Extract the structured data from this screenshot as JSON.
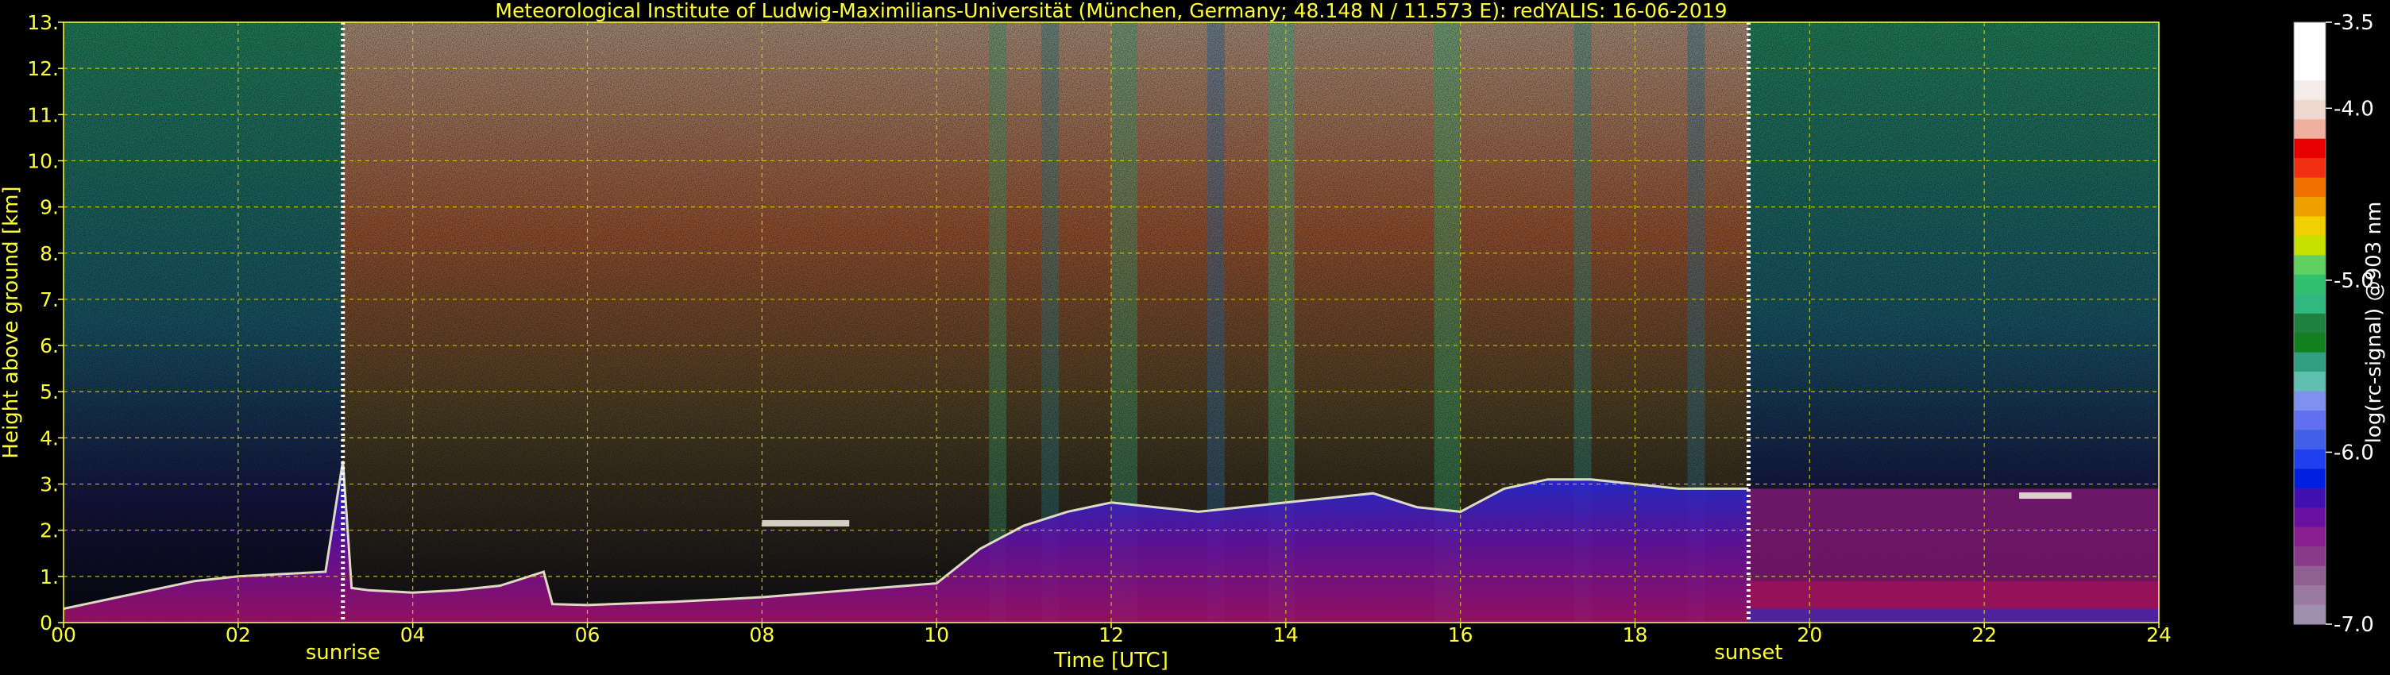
{
  "chart_data": {
    "type": "heatmap",
    "title": "Meteorological Institute of Ludwig-Maximilians-Universität (München, Germany; 48.148 N / 11.573 E):    redYALIS: 16-06-2019",
    "xlabel": "Time [UTC]",
    "ylabel": "Height above ground [km]",
    "xlim": [
      0,
      24
    ],
    "ylim": [
      0,
      13
    ],
    "x_ticks": [
      "00",
      "02",
      "04",
      "06",
      "08",
      "10",
      "12",
      "14",
      "16",
      "18",
      "20",
      "22",
      "24"
    ],
    "y_ticks": [
      "0.",
      "1.",
      "2.",
      "3.",
      "4.",
      "5.",
      "6.",
      "7.",
      "8.",
      "9.",
      "10.",
      "11.",
      "12.",
      "13."
    ],
    "grid": true,
    "annotations": [
      {
        "label": "sunrise",
        "time": 3.2
      },
      {
        "label": "sunset",
        "time": 19.3
      }
    ],
    "colorbar": {
      "label": "log(rc-signal) @903 nm",
      "range": [
        -7.0,
        -3.5
      ],
      "ticks": [
        "-3.5",
        "-4.0",
        "-5.0",
        "-6.0",
        "-7.0"
      ],
      "tick_values": [
        -3.5,
        -4.0,
        -5.0,
        -6.0,
        -7.0
      ]
    },
    "boundary_layer_top_km": {
      "time": [
        0.0,
        0.5,
        1.0,
        1.5,
        2.0,
        2.5,
        3.0,
        3.2,
        3.3,
        3.5,
        4.0,
        4.5,
        5.0,
        5.5,
        5.6,
        6.0,
        7.0,
        8.0,
        9.0,
        10.0,
        10.5,
        11.0,
        11.5,
        12.0,
        12.5,
        13.0,
        13.5,
        14.0,
        14.5,
        15.0,
        15.5,
        16.0,
        16.5,
        17.0,
        17.5,
        18.0,
        18.5,
        19.0,
        19.3
      ],
      "height": [
        0.3,
        0.5,
        0.7,
        0.9,
        1.0,
        1.05,
        1.1,
        3.5,
        0.75,
        0.7,
        0.65,
        0.7,
        0.8,
        1.1,
        0.4,
        0.38,
        0.45,
        0.55,
        0.7,
        0.85,
        1.6,
        2.1,
        2.4,
        2.6,
        2.5,
        2.4,
        2.5,
        2.6,
        2.7,
        2.8,
        2.5,
        2.4,
        2.9,
        3.1,
        3.1,
        3.0,
        2.9,
        2.9,
        2.9
      ]
    },
    "elevated_layers": [
      {
        "t0": 8.0,
        "t1": 9.0,
        "h": 2.15
      },
      {
        "t0": 22.4,
        "t1": 23.0,
        "h": 2.75
      }
    ],
    "colors": {
      "foreground_text": "#ffff33",
      "grid": "#cccc22",
      "background": "#000000"
    }
  }
}
